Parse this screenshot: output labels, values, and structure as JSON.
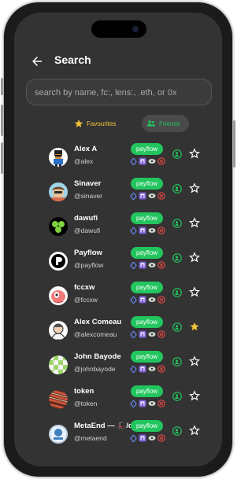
{
  "header": {
    "title": "Search"
  },
  "search": {
    "placeholder": "search by name, fc:, lens:, .eth, or 0x"
  },
  "tabs": [
    {
      "label": "Favourites",
      "active": false
    },
    {
      "label": "Friends",
      "active": true
    }
  ],
  "pay_label": "payflow",
  "users": [
    {
      "name": "Alex A",
      "handle": "@alex",
      "favorite": false
    },
    {
      "name": "Sinaver",
      "handle": "@sinaver",
      "favorite": false
    },
    {
      "name": "dawufi",
      "handle": "@dawufi",
      "favorite": false
    },
    {
      "name": "Payflow",
      "handle": "@payflow",
      "favorite": false
    },
    {
      "name": "fccxw",
      "handle": "@fccxw",
      "favorite": false
    },
    {
      "name": "Alex Comeau",
      "handle": "@alexcomeau",
      "favorite": true
    },
    {
      "name": "John Bayode",
      "handle": "@johnbayode",
      "favorite": false
    },
    {
      "name": "token",
      "handle": "@token",
      "favorite": false
    },
    {
      "name": "MetaEnd — 🎩/dau",
      "handle": "@metaend",
      "favorite": false
    }
  ],
  "colors": {
    "screen_bg": "#333333",
    "accent_green": "#22c55e",
    "star_yellow": "#f3c33b"
  },
  "icons": {
    "back": "arrow-left-icon",
    "favourites": "star-icon",
    "friends": "people-icon",
    "badge_eth": "ethereum-diamond-icon",
    "badge_fc": "farcaster-icon",
    "badge_lens": "lens-icon",
    "badge_cross": "cancel-circle-icon",
    "action": "person-add-icon",
    "favorite": "star-outline-icon"
  }
}
